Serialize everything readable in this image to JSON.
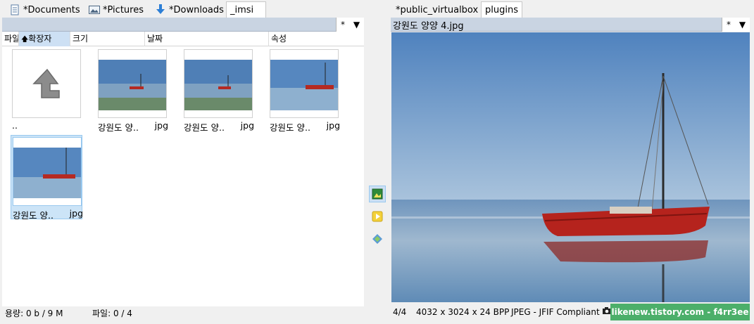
{
  "left_tabs": [
    {
      "label": "*Documents",
      "icon": "document-icon"
    },
    {
      "label": "*Pictures",
      "icon": "pictures-icon"
    },
    {
      "label": "*Downloads",
      "icon": "download-arrow-icon"
    },
    {
      "label": "_imsi",
      "active": true
    }
  ],
  "right_tabs": [
    {
      "label": "*public_virtualbox"
    },
    {
      "label": "plugins",
      "active": true
    }
  ],
  "left_panel": {
    "filter_label": "*",
    "columns": [
      "파일",
      "확장자",
      "크기",
      "날짜",
      "속성"
    ],
    "items": [
      {
        "name": "..",
        "ext": "",
        "type": "parent"
      },
      {
        "name": "강원도 양..",
        "ext": "jpg"
      },
      {
        "name": "강원도 양..",
        "ext": "jpg"
      },
      {
        "name": "강원도 양..",
        "ext": "jpg"
      },
      {
        "name": "강원도 양..",
        "ext": "jpg",
        "selected": true
      }
    ],
    "status_capacity": "용량: 0 b / 9 M",
    "status_files": "파일: 0 / 4"
  },
  "right_panel": {
    "path": "강원도 양양 4.jpg",
    "filter_label": "*",
    "status_index": "4/4",
    "status_dims": "4032 x 3024 x 24 BPP",
    "status_format": "JPEG - JFIF Compliant",
    "watermark": "likenew.tistory.com - f4rr3ee"
  },
  "colors": {
    "selection": "#cce4f7",
    "path_bar": "#c9d4e2",
    "watermark_bg": "#4caf6a"
  },
  "sidebar_icons": [
    "image-view-icon",
    "play-icon",
    "open-with-icon"
  ]
}
